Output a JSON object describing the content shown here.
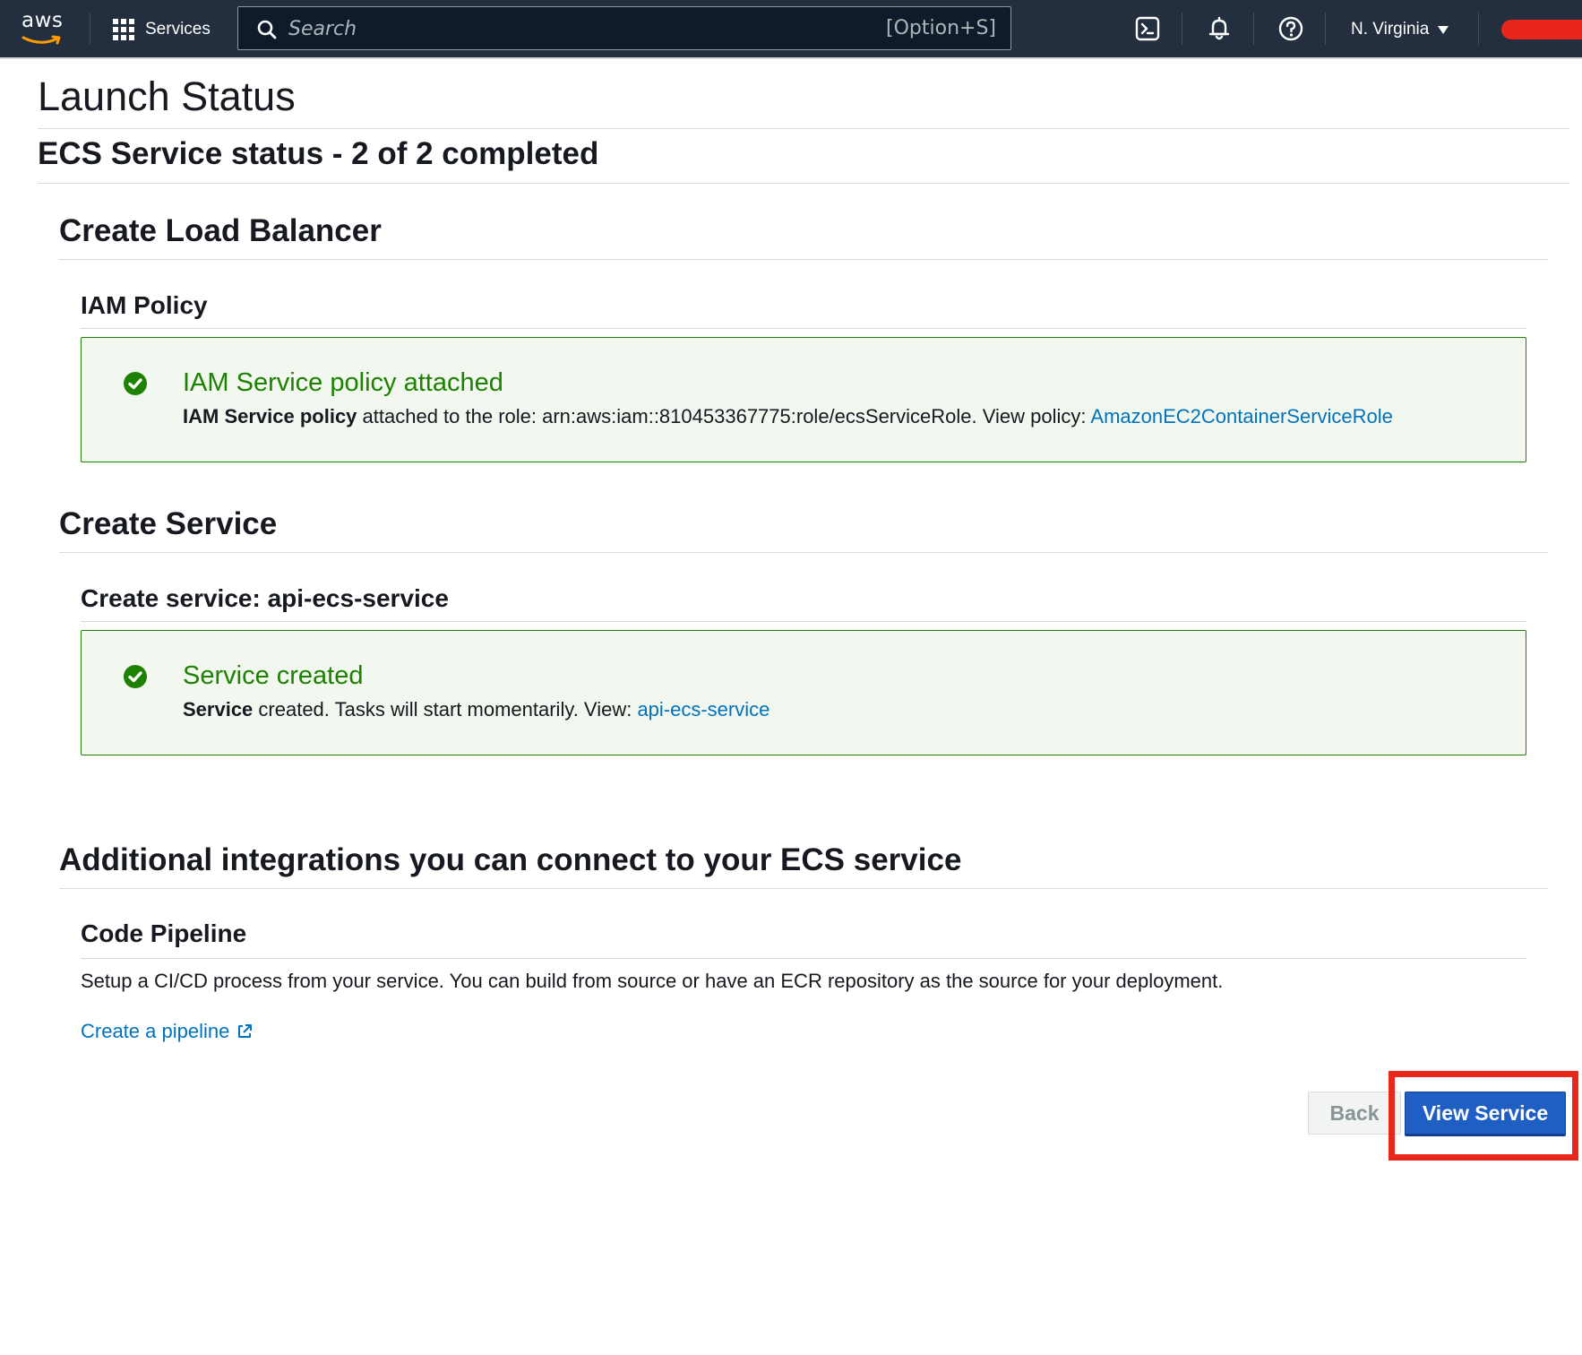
{
  "nav": {
    "logo_text": "aws",
    "services_label": "Services",
    "search_placeholder": "Search",
    "search_shortcut": "[Option+S]",
    "region_label": "N. Virginia",
    "icons": [
      "cloudshell-icon",
      "bell-icon",
      "help-icon"
    ]
  },
  "page": {
    "title": "Launch Status",
    "status_heading": "ECS Service status - 2 of 2 completed"
  },
  "load_balancer": {
    "heading": "Create Load Balancer",
    "subheading": "IAM Policy",
    "alert": {
      "title": "IAM Service policy attached",
      "body_bold": "IAM Service policy",
      "body_text": " attached to the role: arn:aws:iam::810453367775:role/ecsServiceRole. View policy: ",
      "link": "AmazonEC2ContainerServiceRole",
      "status_color": "#1d8102"
    }
  },
  "service": {
    "heading": "Create Service",
    "subheading": "Create service: api-ecs-service",
    "alert": {
      "title": "Service created",
      "body_bold": "Service",
      "body_text": " created. Tasks will start momentarily. View: ",
      "link": "api-ecs-service",
      "status_color": "#1d8102"
    }
  },
  "integrations": {
    "heading": "Additional integrations you can connect to your ECS service",
    "pipeline": {
      "heading": "Code Pipeline",
      "description": "Setup a CI/CD process from your service. You can build from source or have an ECR repository as the source for your deployment.",
      "link": "Create a pipeline"
    }
  },
  "actions": {
    "back_label": "Back",
    "view_service_label": "View Service",
    "highlight_color": "#e8271a"
  },
  "colors": {
    "nav_bg": "#232f3e",
    "link": "#0073bb",
    "primary_button": "#1f5fc4",
    "success": "#1d8102"
  }
}
